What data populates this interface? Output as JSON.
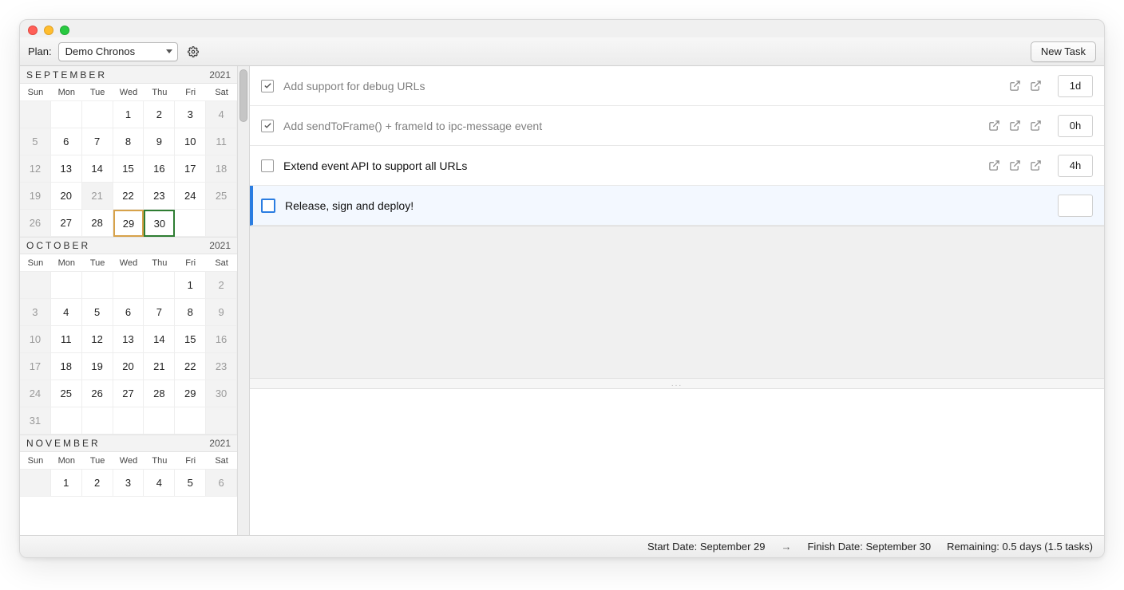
{
  "toolbar": {
    "plan_label": "Plan:",
    "plan_value": "Demo Chronos",
    "new_task": "New Task"
  },
  "dow": [
    "Sun",
    "Mon",
    "Tue",
    "Wed",
    "Thu",
    "Fri",
    "Sat"
  ],
  "months": [
    {
      "name": "SEPTEMBER",
      "year": "2021",
      "weeks": [
        [
          {
            "d": "",
            "w": true
          },
          {
            "d": ""
          },
          {
            "d": ""
          },
          {
            "d": "1"
          },
          {
            "d": "2"
          },
          {
            "d": "3"
          },
          {
            "d": "4",
            "w": true
          }
        ],
        [
          {
            "d": "5",
            "w": true
          },
          {
            "d": "6"
          },
          {
            "d": "7"
          },
          {
            "d": "8"
          },
          {
            "d": "9"
          },
          {
            "d": "10"
          },
          {
            "d": "11",
            "w": true
          }
        ],
        [
          {
            "d": "12",
            "w": true
          },
          {
            "d": "13"
          },
          {
            "d": "14"
          },
          {
            "d": "15"
          },
          {
            "d": "16"
          },
          {
            "d": "17"
          },
          {
            "d": "18",
            "w": true
          }
        ],
        [
          {
            "d": "19",
            "w": true
          },
          {
            "d": "20"
          },
          {
            "d": "21",
            "w": true
          },
          {
            "d": "22"
          },
          {
            "d": "23"
          },
          {
            "d": "24"
          },
          {
            "d": "25",
            "w": true
          }
        ],
        [
          {
            "d": "26",
            "w": true
          },
          {
            "d": "27"
          },
          {
            "d": "28"
          },
          {
            "d": "29",
            "hl": "orange"
          },
          {
            "d": "30",
            "hl": "green"
          },
          {
            "d": ""
          },
          {
            "d": "",
            "w": true
          }
        ]
      ]
    },
    {
      "name": "OCTOBER",
      "year": "2021",
      "weeks": [
        [
          {
            "d": "",
            "w": true
          },
          {
            "d": ""
          },
          {
            "d": ""
          },
          {
            "d": ""
          },
          {
            "d": ""
          },
          {
            "d": "1"
          },
          {
            "d": "2",
            "w": true
          }
        ],
        [
          {
            "d": "3",
            "w": true
          },
          {
            "d": "4"
          },
          {
            "d": "5"
          },
          {
            "d": "6"
          },
          {
            "d": "7"
          },
          {
            "d": "8"
          },
          {
            "d": "9",
            "w": true
          }
        ],
        [
          {
            "d": "10",
            "w": true
          },
          {
            "d": "11"
          },
          {
            "d": "12"
          },
          {
            "d": "13"
          },
          {
            "d": "14"
          },
          {
            "d": "15"
          },
          {
            "d": "16",
            "w": true
          }
        ],
        [
          {
            "d": "17",
            "w": true
          },
          {
            "d": "18"
          },
          {
            "d": "19"
          },
          {
            "d": "20"
          },
          {
            "d": "21"
          },
          {
            "d": "22"
          },
          {
            "d": "23",
            "w": true
          }
        ],
        [
          {
            "d": "24",
            "w": true
          },
          {
            "d": "25"
          },
          {
            "d": "26"
          },
          {
            "d": "27"
          },
          {
            "d": "28"
          },
          {
            "d": "29"
          },
          {
            "d": "30",
            "w": true
          }
        ],
        [
          {
            "d": "31",
            "w": true
          },
          {
            "d": ""
          },
          {
            "d": ""
          },
          {
            "d": ""
          },
          {
            "d": ""
          },
          {
            "d": ""
          },
          {
            "d": "",
            "w": true
          }
        ]
      ]
    },
    {
      "name": "NOVEMBER",
      "year": "2021",
      "weeks": [
        [
          {
            "d": "",
            "w": true
          },
          {
            "d": "1"
          },
          {
            "d": "2"
          },
          {
            "d": "3"
          },
          {
            "d": "4"
          },
          {
            "d": "5"
          },
          {
            "d": "6",
            "w": true
          }
        ]
      ]
    }
  ],
  "tasks": [
    {
      "done": true,
      "title": "Add support for debug URLs",
      "links": 2,
      "dur": "1d",
      "selected": false,
      "big": false
    },
    {
      "done": true,
      "title": "Add sendToFrame() + frameId to ipc-message event",
      "links": 3,
      "dur": "0h",
      "selected": false,
      "big": false
    },
    {
      "done": false,
      "title": "Extend event API to support all URLs",
      "links": 3,
      "dur": "4h",
      "selected": false,
      "big": false
    },
    {
      "done": false,
      "title": "Release, sign and deploy!",
      "links": 0,
      "dur": "",
      "selected": true,
      "big": true
    }
  ],
  "notes_handle": "...",
  "status": {
    "start_label": "Start Date:",
    "start_value": "September 29",
    "arrow": "→",
    "finish_label": "Finish Date:",
    "finish_value": "September 30",
    "remaining_label": "Remaining:",
    "remaining_value": "0.5 days (1.5 tasks)"
  }
}
